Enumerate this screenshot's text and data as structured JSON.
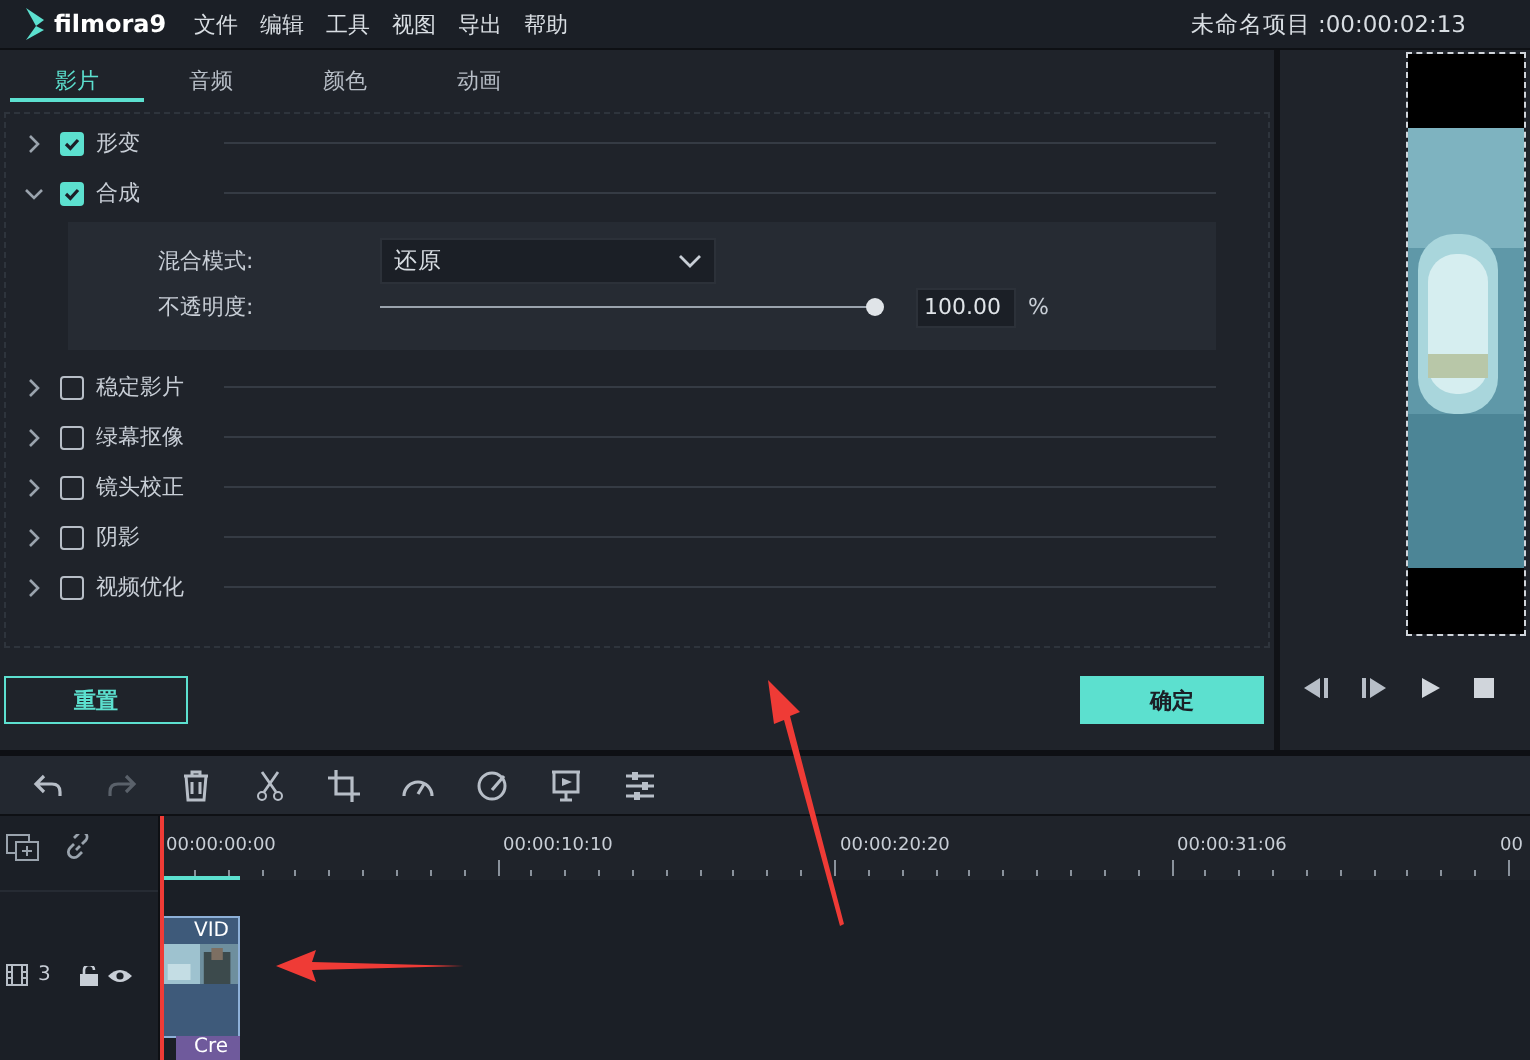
{
  "app": {
    "logo": "filmora9",
    "menu": [
      "文件",
      "编辑",
      "工具",
      "视图",
      "导出",
      "帮助"
    ],
    "project_title": "未命名项目 :00:00:02:13"
  },
  "tabs": [
    {
      "label": "影片",
      "selected": true
    },
    {
      "label": "音频",
      "selected": false
    },
    {
      "label": "颜色",
      "selected": false
    },
    {
      "label": "动画",
      "selected": false
    }
  ],
  "sections": [
    {
      "label": "形变",
      "checked": true,
      "expanded": false
    },
    {
      "label": "合成",
      "checked": true,
      "expanded": true
    },
    {
      "label": "稳定影片",
      "checked": false,
      "expanded": false
    },
    {
      "label": "绿幕抠像",
      "checked": false,
      "expanded": false
    },
    {
      "label": "镜头校正",
      "checked": false,
      "expanded": false
    },
    {
      "label": "阴影",
      "checked": false,
      "expanded": false
    },
    {
      "label": "视频优化",
      "checked": false,
      "expanded": false
    }
  ],
  "composite": {
    "blend_label": "混合模式:",
    "blend_value": "还原",
    "opacity_label": "不透明度:",
    "opacity": {
      "level": 1.0,
      "value": "100.00",
      "unit": "%"
    }
  },
  "buttons": {
    "reset": "重置",
    "ok": "确定"
  },
  "timeline": {
    "ruler": [
      "00:00:00:00",
      "00:00:10:10",
      "00:00:20:20",
      "00:00:31:06",
      "00"
    ],
    "track_number": "3",
    "clips": [
      "VID",
      "Cre"
    ]
  }
}
